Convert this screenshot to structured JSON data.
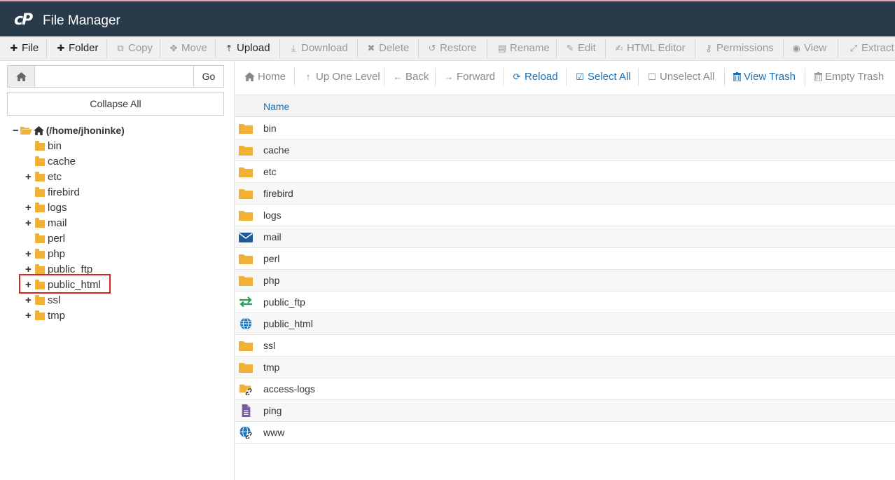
{
  "app": {
    "logo": "cP",
    "title": "File Manager"
  },
  "toolbar": [
    {
      "label": "File",
      "icon": "plus-icon",
      "enabled": true
    },
    {
      "label": "Folder",
      "icon": "plus-icon",
      "enabled": true
    },
    {
      "label": "Copy",
      "icon": "copy-icon",
      "enabled": false
    },
    {
      "label": "Move",
      "icon": "move-icon",
      "enabled": false
    },
    {
      "label": "Upload",
      "icon": "upload-icon",
      "enabled": true
    },
    {
      "label": "Download",
      "icon": "download-icon",
      "enabled": false
    },
    {
      "label": "Delete",
      "icon": "x-icon",
      "enabled": false
    },
    {
      "label": "Restore",
      "icon": "restore-icon",
      "enabled": false
    },
    {
      "label": "Rename",
      "icon": "file-icon",
      "enabled": false
    },
    {
      "label": "Edit",
      "icon": "pencil-icon",
      "enabled": false
    },
    {
      "label": "HTML Editor",
      "icon": "edit-icon",
      "enabled": false
    },
    {
      "label": "Permissions",
      "icon": "key-icon",
      "enabled": false
    },
    {
      "label": "View",
      "icon": "eye-icon",
      "enabled": false
    },
    {
      "label": "Extract",
      "icon": "expand-icon",
      "enabled": false
    }
  ],
  "left": {
    "path_value": "",
    "go_label": "Go",
    "collapse_label": "Collapse All",
    "root_label": "(/home/jhoninke)",
    "tree": [
      {
        "label": "bin",
        "expandable": false
      },
      {
        "label": "cache",
        "expandable": false
      },
      {
        "label": "etc",
        "expandable": true
      },
      {
        "label": "firebird",
        "expandable": false
      },
      {
        "label": "logs",
        "expandable": true
      },
      {
        "label": "mail",
        "expandable": true
      },
      {
        "label": "perl",
        "expandable": false
      },
      {
        "label": "php",
        "expandable": true
      },
      {
        "label": "public_ftp",
        "expandable": true
      },
      {
        "label": "public_html",
        "expandable": true
      },
      {
        "label": "ssl",
        "expandable": true
      },
      {
        "label": "tmp",
        "expandable": true
      }
    ]
  },
  "nav": [
    {
      "label": "Home",
      "icon": "home-icon",
      "style": "gray"
    },
    {
      "label": "Up One Level",
      "icon": "arrow-up-icon",
      "style": "gray"
    },
    {
      "label": "Back",
      "icon": "arrow-left-icon",
      "style": "gray"
    },
    {
      "label": "Forward",
      "icon": "arrow-right-icon",
      "style": "gray"
    },
    {
      "label": "Reload",
      "icon": "reload-icon",
      "style": "blue"
    },
    {
      "label": "Select All",
      "icon": "checkbox-checked-icon",
      "style": "blue"
    },
    {
      "label": "Unselect All",
      "icon": "checkbox-empty-icon",
      "style": "gray"
    },
    {
      "label": "View Trash",
      "icon": "trash-icon",
      "style": "blue"
    },
    {
      "label": "Empty Trash",
      "icon": "trash-icon",
      "style": "gray"
    }
  ],
  "list_header": "Name",
  "files": [
    {
      "name": "bin",
      "icon": "folder-icon"
    },
    {
      "name": "cache",
      "icon": "folder-icon"
    },
    {
      "name": "etc",
      "icon": "folder-icon"
    },
    {
      "name": "firebird",
      "icon": "folder-icon"
    },
    {
      "name": "logs",
      "icon": "folder-icon"
    },
    {
      "name": "mail",
      "icon": "mail-icon"
    },
    {
      "name": "perl",
      "icon": "folder-icon"
    },
    {
      "name": "php",
      "icon": "folder-icon"
    },
    {
      "name": "public_ftp",
      "icon": "transfer-icon"
    },
    {
      "name": "public_html",
      "icon": "globe-icon"
    },
    {
      "name": "ssl",
      "icon": "folder-icon"
    },
    {
      "name": "tmp",
      "icon": "folder-icon"
    },
    {
      "name": "access-logs",
      "icon": "folder-link-icon"
    },
    {
      "name": "ping",
      "icon": "document-icon"
    },
    {
      "name": "www",
      "icon": "globe-link-icon"
    }
  ],
  "colors": {
    "topbar": "#293a4a",
    "accent": "#1a6fb5",
    "folder": "#f0b136",
    "highlight": "#e01f1f"
  }
}
